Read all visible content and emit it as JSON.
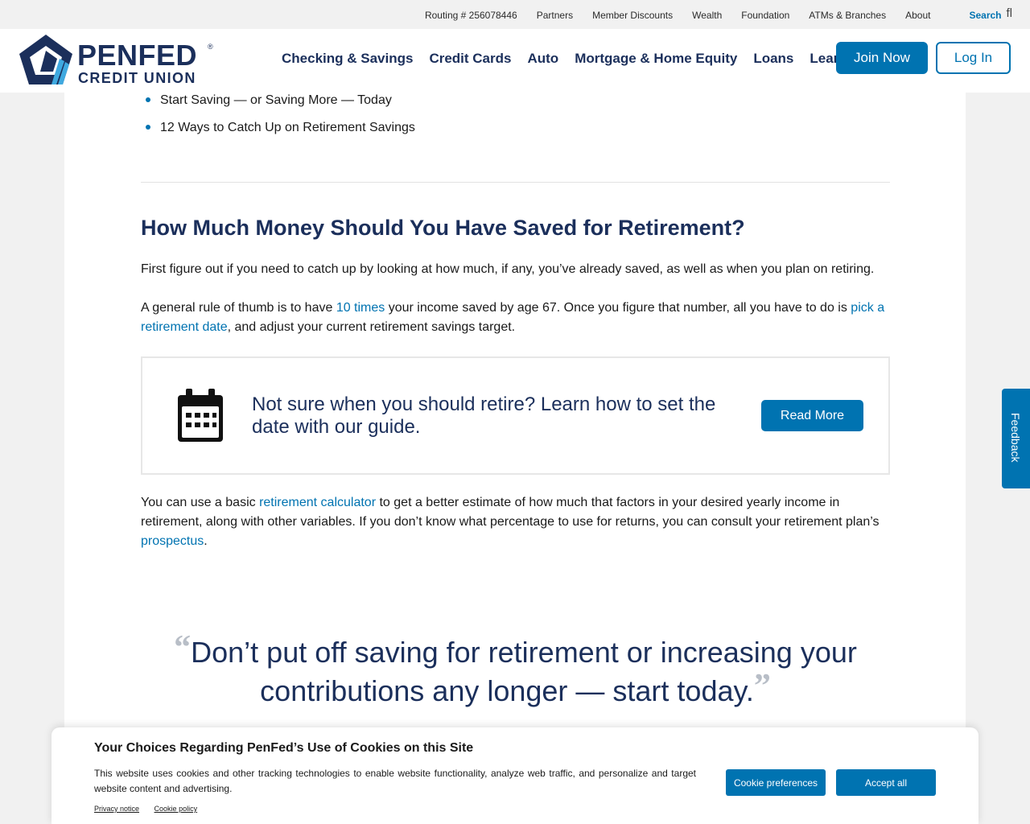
{
  "utility_bar": {
    "routing": "Routing # 256078446",
    "links": [
      "Partners",
      "Member Discounts",
      "Wealth",
      "Foundation",
      "ATMs & Branches",
      "About"
    ],
    "search_label": "Search"
  },
  "header": {
    "logo_word1": "PENFED",
    "logo_word2": "CREDIT UNION",
    "logo_reg": "®",
    "nav": [
      "Checking & Savings",
      "Credit Cards",
      "Auto",
      "Mortgage & Home Equity",
      "Loans",
      "Learn"
    ],
    "join_label": "Join Now",
    "login_label": "Log In"
  },
  "article": {
    "bullets": [
      "Start Saving — or Saving More — Today",
      "12 Ways to Catch Up on Retirement Savings"
    ],
    "heading": "How Much Money Should You Have Saved for Retirement?",
    "p1": "First figure out if you need to catch up by looking at how much, if any, you’ve already saved, as well as when you plan on retiring.",
    "p2": {
      "a": "A general rule of thumb is to have ",
      "link1": "10 times",
      "b": " your income saved by age 67. Once you figure that number, all you have to do is ",
      "link2": "pick a retirement date",
      "c": ", and adjust your current retirement savings target."
    },
    "callout": {
      "text": "Not sure when you should retire? Learn how to set the date with our guide.",
      "button": "Read More"
    },
    "p3": {
      "a": "You can use a basic ",
      "link1": "retirement calculator",
      "b": " to get a better estimate of how much that factors in your desired yearly income in retirement, along with other variables. If you don’t know what percentage to use for returns, you can consult your retirement plan’s ",
      "link2": "prospectus",
      "c": "."
    },
    "quote": {
      "open": "“",
      "text": "Don’t put off saving for retirement or increasing your contributions any longer — start today.",
      "close": "”"
    }
  },
  "feedback_label": "Feedback",
  "cookie_banner": {
    "title": "Your Choices Regarding PenFed’s Use of Cookies on this Site",
    "body": "This website uses cookies and other tracking technologies to enable website functionality, analyze web traffic, and personalize and target website content and advertising.",
    "links": [
      "Privacy notice",
      "Cookie policy"
    ],
    "pref_button": "Cookie preferences",
    "accept_button": "Accept all"
  },
  "colors": {
    "brand_blue": "#0073b1",
    "navy": "#1b2f5b",
    "logo_light_blue": "#3fa9e0"
  }
}
